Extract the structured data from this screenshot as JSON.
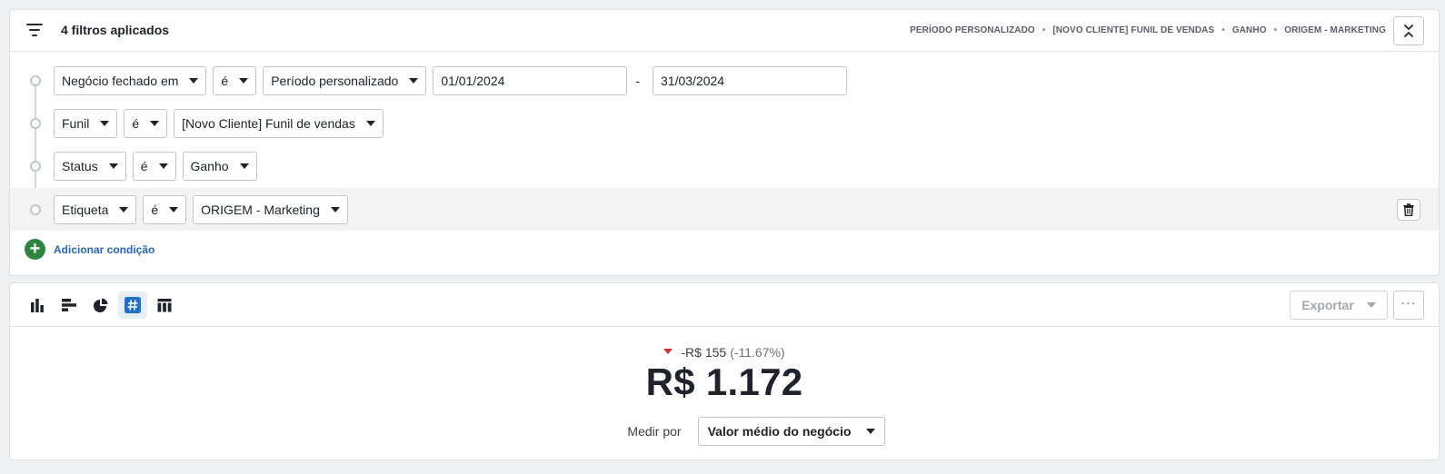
{
  "filters": {
    "count_label": "4 filtros aplicados",
    "summary": [
      "PERÍODO PERSONALIZADO",
      "[NOVO CLIENTE] FUNIL DE VENDAS",
      "GANHO",
      "ORIGEM - MARKETING"
    ],
    "summary_separator": "•",
    "rows": [
      {
        "field": "Negócio fechado em",
        "operator": "é",
        "value": "Período personalizado",
        "date_from": "01/01/2024",
        "date_sep": "-",
        "date_to": "31/03/2024"
      },
      {
        "field": "Funil",
        "operator": "é",
        "value": "[Novo Cliente] Funil de vendas"
      },
      {
        "field": "Status",
        "operator": "é",
        "value": "Ganho"
      },
      {
        "field": "Etiqueta",
        "operator": "é",
        "value": "ORIGEM - Marketing"
      }
    ],
    "add_condition_label": "Adicionar condição"
  },
  "report": {
    "view_icons": [
      "bar-chart-icon",
      "horizontal-bar-icon",
      "pie-chart-icon",
      "number-icon",
      "table-icon"
    ],
    "active_view": "number-icon",
    "export_label": "Exportar",
    "more_label": "···",
    "delta_value": "-R$ 155",
    "delta_percent": "(-11.67%)",
    "main_value": "R$ 1.172",
    "measure_label": "Medir por",
    "measure_value": "Valor médio do negócio"
  },
  "colors": {
    "add_green": "#2e8540",
    "link_blue": "#2468c4",
    "down_red": "#d52b2b",
    "active_view": "#1f6fd1"
  }
}
